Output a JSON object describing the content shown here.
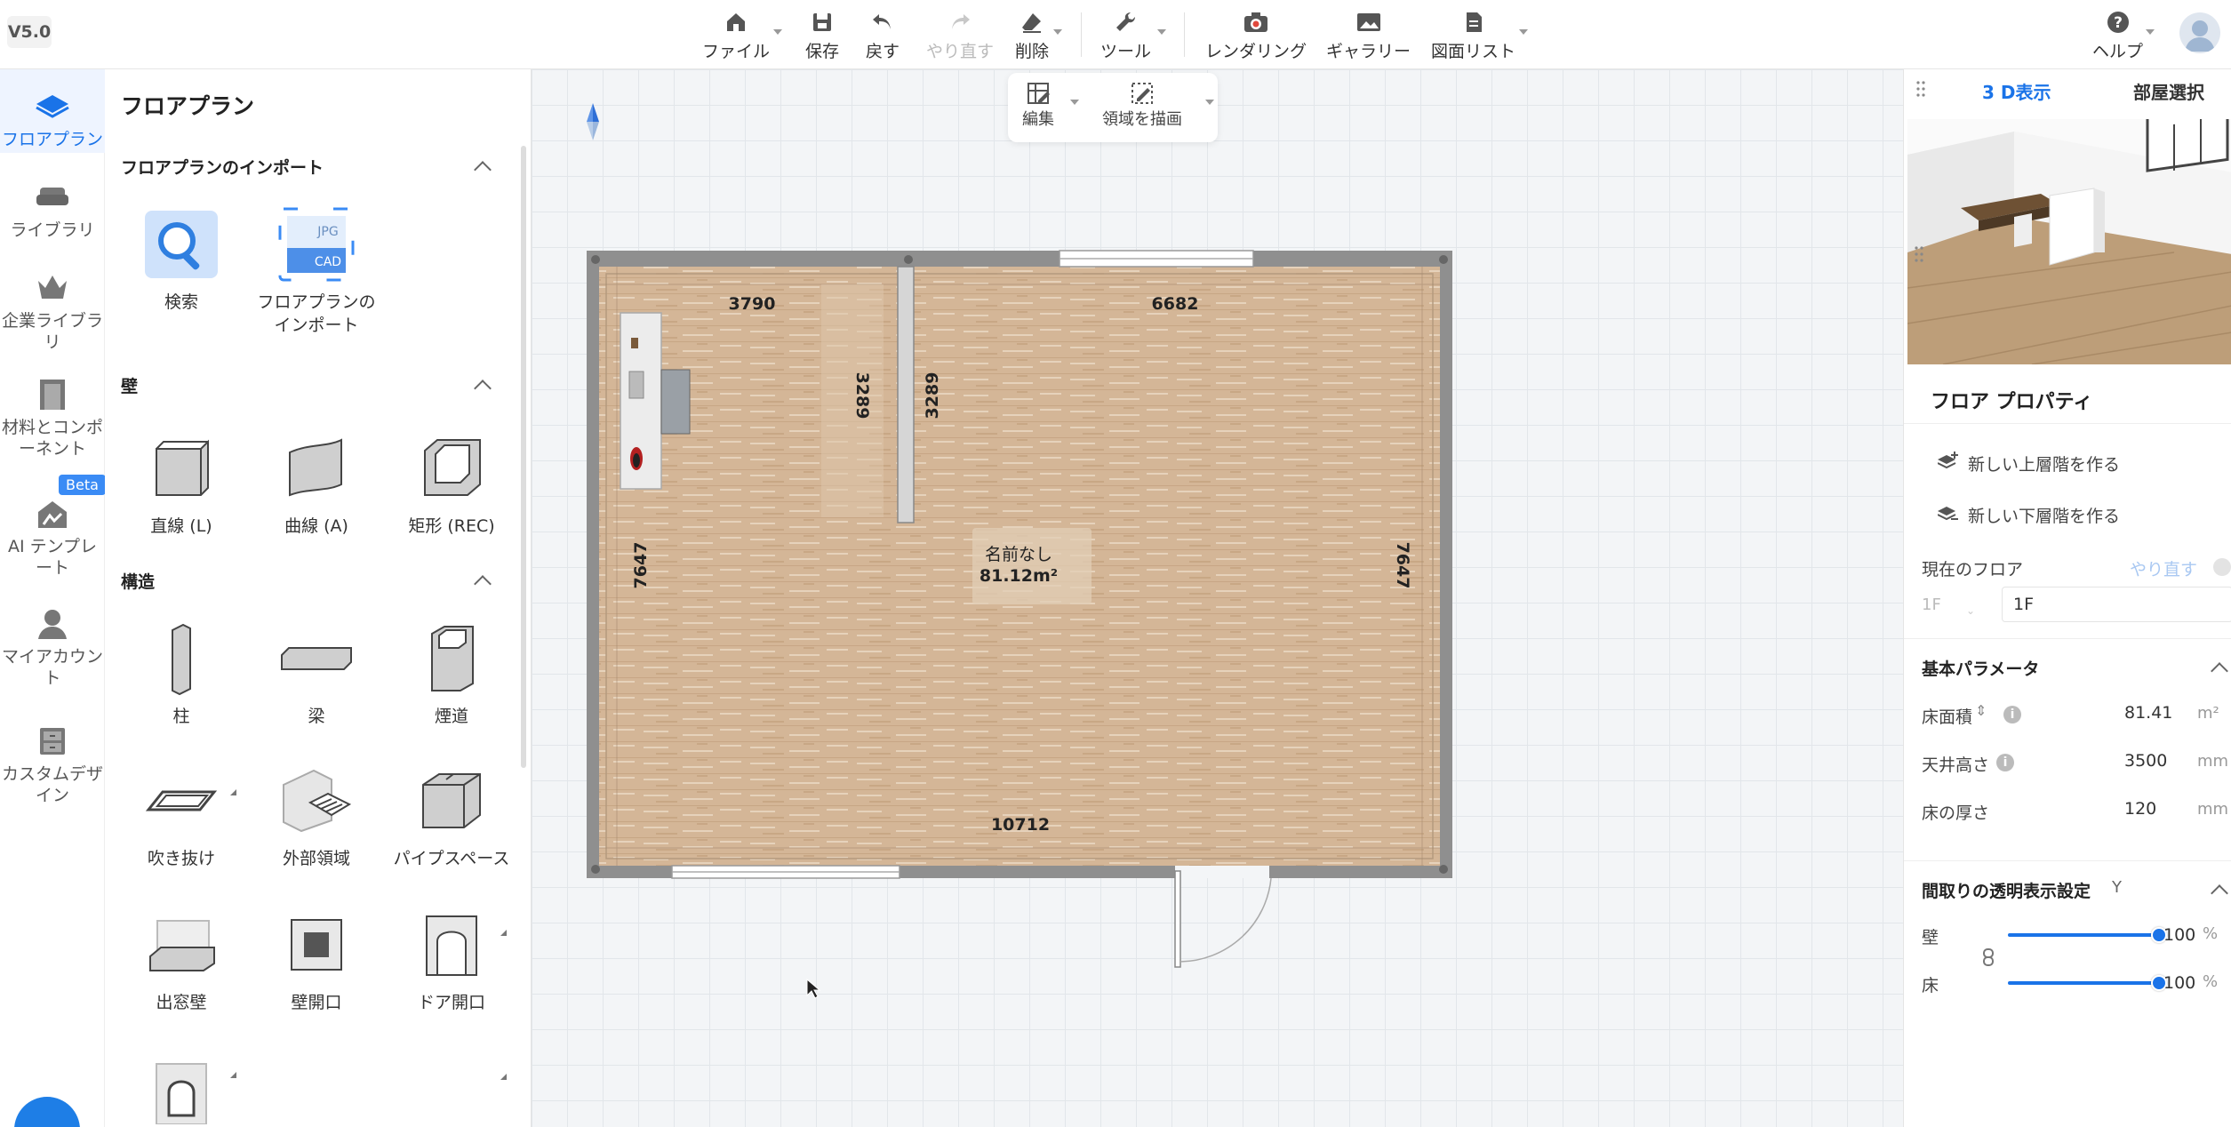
{
  "app": {
    "version": "V5.0"
  },
  "toolbar": {
    "file": "ファイル",
    "save": "保存",
    "undo": "戻す",
    "redo": "やり直す",
    "delete": "削除",
    "tools": "ツール",
    "rendering": "レンダリング",
    "gallery": "ギャラリー",
    "drawing_list": "図面リスト",
    "help": "ヘルプ"
  },
  "rail": {
    "items": [
      {
        "label": "フロアプラン",
        "icon": "floorplan-icon",
        "active": true
      },
      {
        "label": "ライブラリ",
        "icon": "sofa-icon"
      },
      {
        "label": "企業ライブラリ",
        "icon": "crown-icon"
      },
      {
        "label": "材料とコンポーネント",
        "icon": "door-icon"
      },
      {
        "label": "AI テンプレート",
        "icon": "ai-house-icon",
        "badge": "Beta"
      },
      {
        "label": "マイアカウント",
        "icon": "user-icon"
      },
      {
        "label": "カスタムデザイン",
        "icon": "cabinet-icon"
      }
    ]
  },
  "panel": {
    "title": "フロアプラン",
    "sections": {
      "import": "フロアプランのインポート",
      "walls": "壁",
      "structure": "構造"
    },
    "import_items": {
      "search": "検索",
      "import": "フロアプランの\nインポート",
      "import_badge_top": "JPG",
      "import_badge_bottom": "CAD"
    },
    "wall_items": [
      "直線 (L)",
      "曲線 (A)",
      "矩形 (REC)"
    ],
    "structure_items": [
      "柱",
      "梁",
      "煙道",
      "吹き抜け",
      "外部領域",
      "パイプスペース",
      "出窓壁",
      "壁開口",
      "ドア開口"
    ]
  },
  "canvas": {
    "edit": "編集",
    "draw_area": "領域を描画",
    "room_name": "名前なし",
    "room_area": "81.12m²",
    "dimensions": {
      "top_left": "3790",
      "top_right": "6682",
      "partition_left": "3289",
      "partition_right": "3289",
      "left": "7647",
      "right": "7647",
      "bottom": "10712"
    }
  },
  "right_panel": {
    "tabs": [
      "3 D表示",
      "部屋選択"
    ],
    "title": "フロア プロパティ",
    "new_upper": "新しい上層階を作る",
    "new_lower": "新しい下層階を作る",
    "current_floor_label": "現在のフロア",
    "redo_link": "やり直す",
    "floor_prefix": "1F",
    "floor_name": "1F",
    "basic_params": "基本パラメータ",
    "floor_area_label": "床面積",
    "floor_area_value": "81.41",
    "floor_area_unit": "m²",
    "ceiling_label": "天井高さ",
    "ceiling_value": "3500",
    "ceiling_unit": "mm",
    "floor_thickness_label": "床の厚さ",
    "floor_thickness_value": "120",
    "floor_thickness_unit": "mm",
    "transparency_title": "間取りの透明表示設定",
    "transparency_suffix": "Y",
    "wall_label": "壁",
    "wall_value": "100",
    "floor_label": "床",
    "floor_value": "100",
    "percent": "%",
    "wall_level": 1.0,
    "floor_level": 1.0
  },
  "colors": {
    "accent": "#1a73e8",
    "wall": "#8f8f8f",
    "floor_wood": "#d2b393",
    "grid_bg": "#f3f5f7"
  }
}
